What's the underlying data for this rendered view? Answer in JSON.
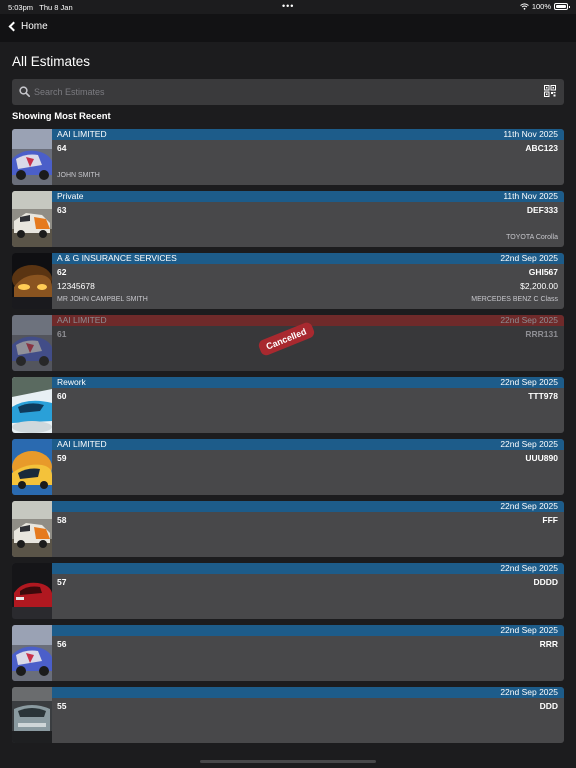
{
  "status_bar": {
    "time": "5:03pm",
    "date": "Thu 8 Jan",
    "battery": "100%"
  },
  "nav": {
    "back_label": "Home"
  },
  "page": {
    "title": "All Estimates",
    "subheading": "Showing Most Recent"
  },
  "search": {
    "placeholder": "Search Estimates",
    "value": ""
  },
  "colors": {
    "header_blue": "#1d5c8a",
    "cancelled_red": "#6f2a2a",
    "stamp_red": "#a8292f",
    "card_bg": "#48484a",
    "page_bg": "#1c1c1e"
  },
  "estimates": [
    {
      "company": "AAI LIMITED",
      "date": "11th Nov 2025",
      "number": "64",
      "reg": "ABC123",
      "ref": "",
      "amount": "",
      "customer": "JOHN SMITH",
      "vehicle": ""
    },
    {
      "company": "Private",
      "date": "11th Nov 2025",
      "number": "63",
      "reg": "DEF333",
      "ref": "",
      "amount": "",
      "customer": "",
      "vehicle": "TOYOTA Corolla"
    },
    {
      "company": "A & G INSURANCE SERVICES",
      "date": "22nd Sep 2025",
      "number": "62",
      "reg": "GHI567",
      "ref": "12345678",
      "amount": "$2,200.00",
      "customer": "MR JOHN CAMPBEL SMITH",
      "vehicle": "MERCEDES BENZ C Class"
    },
    {
      "company": "AAI LIMITED",
      "date": "22nd Sep 2025",
      "number": "61",
      "reg": "RRR131",
      "ref": "",
      "amount": "",
      "customer": "",
      "vehicle": "",
      "status": "Cancelled"
    },
    {
      "company": "Rework",
      "date": "22nd Sep 2025",
      "number": "60",
      "reg": "TTT978",
      "ref": "",
      "amount": "",
      "customer": "",
      "vehicle": ""
    },
    {
      "company": "AAI LIMITED",
      "date": "22nd Sep 2025",
      "number": "59",
      "reg": "UUU890",
      "ref": "",
      "amount": "",
      "customer": "",
      "vehicle": ""
    },
    {
      "company": "",
      "date": "22nd Sep 2025",
      "number": "58",
      "reg": "FFF",
      "ref": "",
      "amount": "",
      "customer": "",
      "vehicle": ""
    },
    {
      "company": "",
      "date": "22nd Sep 2025",
      "number": "57",
      "reg": "DDDD",
      "ref": "",
      "amount": "",
      "customer": "",
      "vehicle": ""
    },
    {
      "company": "",
      "date": "22nd Sep 2025",
      "number": "56",
      "reg": "RRR",
      "ref": "",
      "amount": "",
      "customer": "",
      "vehicle": ""
    },
    {
      "company": "",
      "date": "22nd Sep 2025",
      "number": "55",
      "reg": "DDD",
      "ref": "",
      "amount": "",
      "customer": "",
      "vehicle": ""
    }
  ]
}
